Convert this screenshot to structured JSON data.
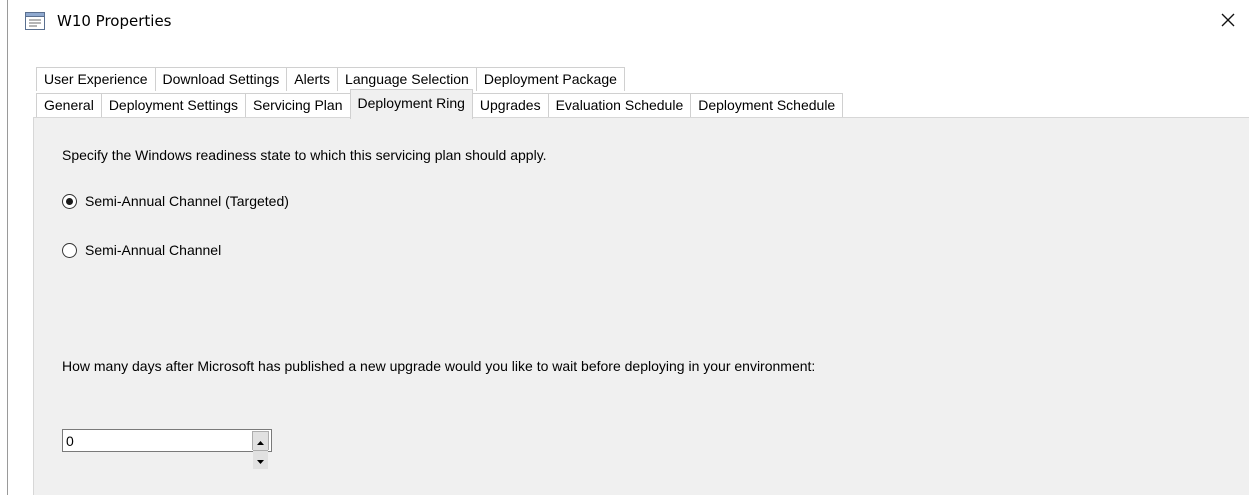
{
  "window": {
    "title": "W10 Properties",
    "icon": "properties-window-icon",
    "close_icon": "close-icon"
  },
  "tabs": {
    "back_row": [
      {
        "label": "User Experience"
      },
      {
        "label": "Download Settings"
      },
      {
        "label": "Alerts"
      },
      {
        "label": "Language Selection"
      },
      {
        "label": "Deployment Package"
      }
    ],
    "front_row": [
      {
        "label": "General"
      },
      {
        "label": "Deployment Settings"
      },
      {
        "label": "Servicing Plan"
      },
      {
        "label": "Deployment Ring",
        "selected": true
      },
      {
        "label": "Upgrades"
      },
      {
        "label": "Evaluation Schedule"
      },
      {
        "label": "Deployment Schedule"
      }
    ],
    "selected": "Deployment Ring"
  },
  "panel": {
    "instruction": "Specify the Windows readiness state to which this servicing plan should apply.",
    "radio_options": [
      {
        "label": "Semi-Annual Channel (Targeted)",
        "checked": true
      },
      {
        "label": "Semi-Annual Channel",
        "checked": false
      }
    ],
    "wait_question": "How many days after Microsoft has published a new upgrade would you like to wait before deploying in your environment:",
    "days_value": "0"
  },
  "colors": {
    "panel_bg": "#f0f0f0",
    "tab_border": "#d0d0d0",
    "window_bg": "#ffffff"
  }
}
